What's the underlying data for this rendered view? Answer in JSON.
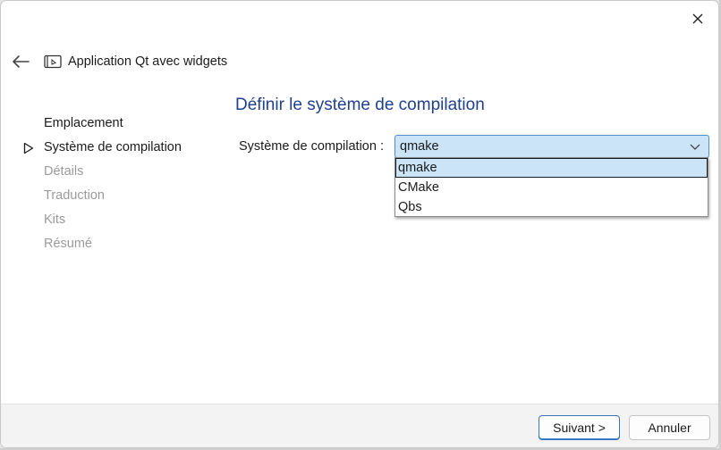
{
  "window": {
    "close_icon": "close-icon"
  },
  "header": {
    "back_icon": "back-arrow-icon",
    "app_icon": "qt-application-icon",
    "title": "Application Qt avec widgets"
  },
  "steps": [
    {
      "label": "Emplacement",
      "state": "done"
    },
    {
      "label": "Système de compilation",
      "state": "current"
    },
    {
      "label": "Détails",
      "state": "pending"
    },
    {
      "label": "Traduction",
      "state": "pending"
    },
    {
      "label": "Kits",
      "state": "pending"
    },
    {
      "label": "Résumé",
      "state": "pending"
    }
  ],
  "page": {
    "title": "Définir le système de compilation",
    "field_label": "Système de compilation :",
    "combo_value": "qmake",
    "options": [
      "qmake",
      "CMake",
      "Qbs"
    ],
    "selected_option": "qmake"
  },
  "footer": {
    "next_label": "Suivant >",
    "cancel_label": "Annuler"
  },
  "colors": {
    "title": "#1f3f8f",
    "selection": "#cce4f7",
    "accent_border": "#4f8fd0",
    "disabled_text": "#9a9a9a"
  }
}
